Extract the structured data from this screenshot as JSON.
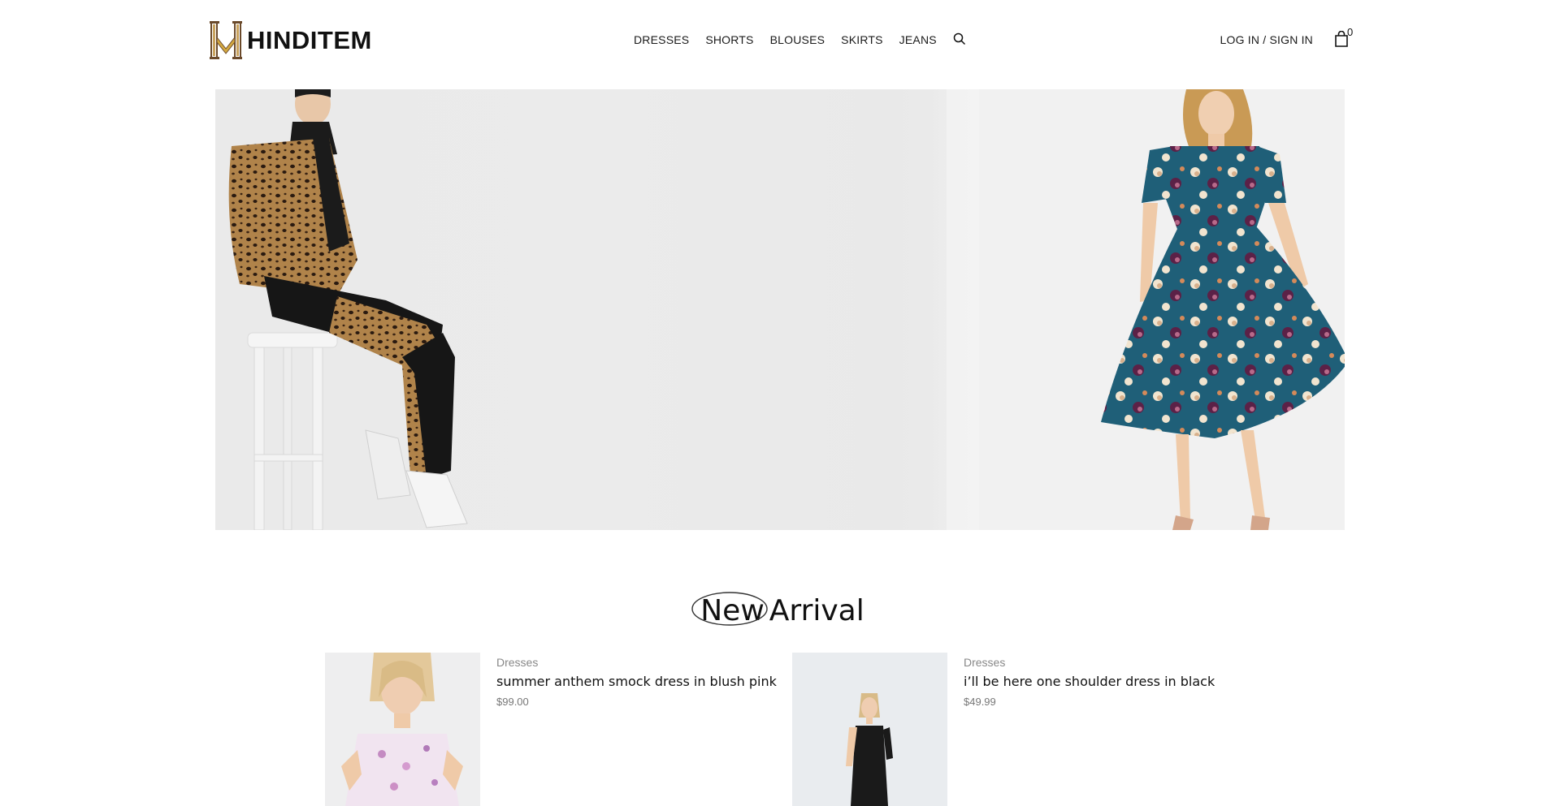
{
  "brand": {
    "name": "HINDITEM"
  },
  "nav": {
    "items": [
      "DRESSES",
      "SHORTS",
      "BLOUSES",
      "SKIRTS",
      "JEANS"
    ]
  },
  "account": {
    "login_label": "LOG IN / SIGN IN"
  },
  "cart": {
    "count": "0"
  },
  "section": {
    "title_first": "New",
    "title_second": "Arrival"
  },
  "products": [
    {
      "category": "Dresses",
      "name": "summer anthem smock dress in blush pink",
      "price": "$99.00"
    },
    {
      "category": "Dresses",
      "name": "i’ll be here one shoulder dress in black",
      "price": "$49.99"
    }
  ],
  "icons": {
    "search": "search-icon",
    "cart": "shopping-bag-icon",
    "logo": "logo-mark-icon"
  },
  "colors": {
    "text": "#111111",
    "muted": "#888888",
    "hero_bg": "#ebebeb",
    "dress_teal": "#1f5f78",
    "logo_gold": "#b8894a"
  }
}
